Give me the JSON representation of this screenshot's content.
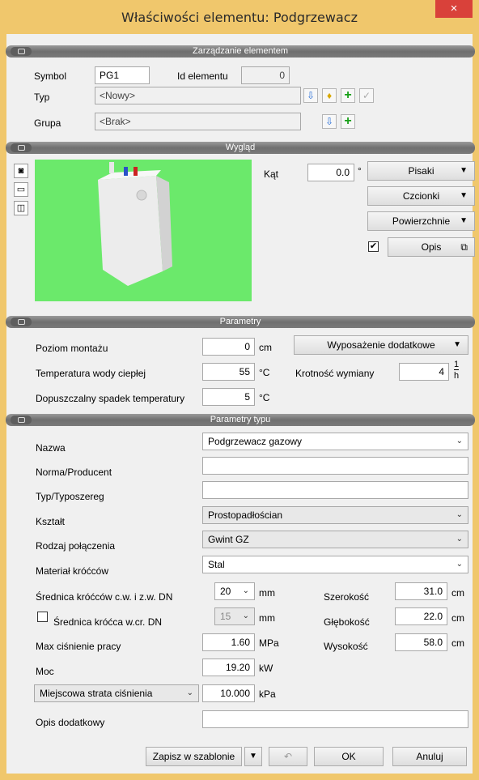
{
  "window": {
    "title": "Właściwości elementu: Podgrzewacz",
    "close_glyph": "×"
  },
  "sections": {
    "zarzadzanie": "Zarządzanie elementem",
    "wyglad": "Wygląd",
    "parametry": "Parametry",
    "parametry_typu": "Parametry typu"
  },
  "management": {
    "symbol_label": "Symbol",
    "symbol_value": "PG1",
    "id_label": "Id elementu",
    "id_value": "0",
    "typ_label": "Typ",
    "typ_value": "<Nowy>",
    "grupa_label": "Grupa",
    "grupa_value": "<Brak>"
  },
  "appearance": {
    "kat_label": "Kąt",
    "kat_value": "0.0",
    "kat_unit": "°",
    "pisaki": "Pisaki",
    "czcionki": "Czcionki",
    "powierzchnie": "Powierzchnie",
    "opis": "Opis",
    "opis_checked": true
  },
  "params": {
    "poziom_label": "Poziom montażu",
    "poziom_value": "0",
    "poziom_unit": "cm",
    "wyposazenie": "Wyposażenie dodatkowe",
    "temp_label": "Temperatura wody ciepłej",
    "temp_value": "55",
    "temp_unit": "°C",
    "krotnosc_label": "Krotność wymiany",
    "krotnosc_value": "4",
    "krotnosc_unit_num": "1",
    "krotnosc_unit_den": "h",
    "spadek_label": "Dopuszczalny spadek temperatury",
    "spadek_value": "5",
    "spadek_unit": "°C"
  },
  "type_params": {
    "nazwa_label": "Nazwa",
    "nazwa_value": "Podgrzewacz gazowy",
    "norma_label": "Norma/Producent",
    "norma_value": "",
    "typ_label": "Typ/Typoszereg",
    "typ_value": "",
    "ksztalt_label": "Kształt",
    "ksztalt_value": "Prostopadłościan",
    "polaczenie_label": "Rodzaj połączenia",
    "polaczenie_value": "Gwint GZ",
    "material_label": "Materiał króćców",
    "material_value": "Stal",
    "sred_cw_label": "Średnica króćców c.w. i z.w. DN",
    "sred_cw_value": "20",
    "sred_cw_unit": "mm",
    "szer_label": "Szerokość",
    "szer_value": "31.0",
    "szer_unit": "cm",
    "sred_wcr_label": "Średnica króćca w.cr. DN",
    "sred_wcr_value": "15",
    "sred_wcr_unit": "mm",
    "sred_wcr_checked": false,
    "glab_label": "Głębokość",
    "glab_value": "22.0",
    "glab_unit": "cm",
    "cisn_label": "Max ciśnienie pracy",
    "cisn_value": "1.60",
    "cisn_unit": "MPa",
    "wys_label": "Wysokość",
    "wys_value": "58.0",
    "wys_unit": "cm",
    "moc_label": "Moc",
    "moc_value": "19.20",
    "moc_unit": "kW",
    "strata_select": "Miejscowa strata ciśnienia",
    "strata_value": "10.000",
    "strata_unit": "kPa",
    "opis_label": "Opis dodatkowy",
    "opis_value": ""
  },
  "footer": {
    "zapisz": "Zapisz w szablonie",
    "ok": "OK",
    "anuluj": "Anuluj"
  },
  "colors": {
    "title_bar": "#f0c76c",
    "close": "#d9413a",
    "preview_bg": "#6be96b",
    "section_bar": "#7a7a7a"
  }
}
